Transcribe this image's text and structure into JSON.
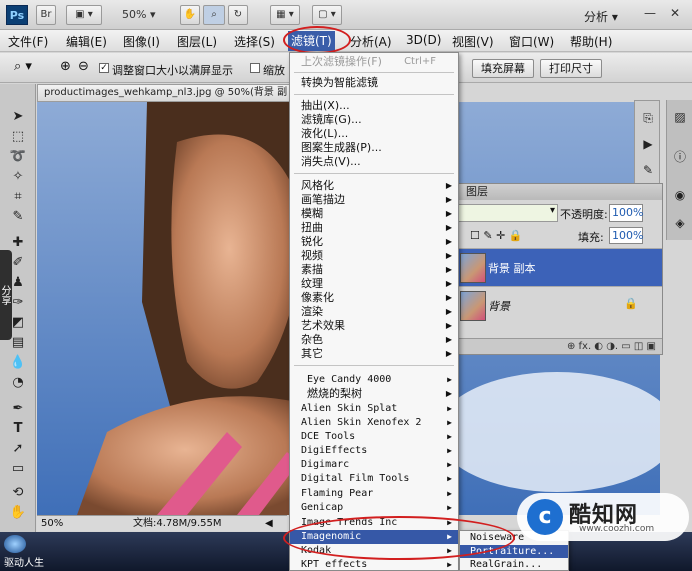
{
  "appbar": {
    "logo": "Ps",
    "br": "Br",
    "zoom": "50%",
    "analysis": "分析",
    "minimize": "—",
    "close": "✕"
  },
  "menubar": {
    "items": [
      "文件(F)",
      "编辑(E)",
      "图像(I)",
      "图层(L)",
      "选择(S)",
      "滤镜(T)",
      "分析(A)",
      "3D(D)",
      "视图(V)",
      "窗口(W)",
      "帮助(H)"
    ]
  },
  "options": {
    "resize_windows": "调整窗口大小以满屏显示",
    "zoom_all": "缩放",
    "fill_screen": "填充屏幕",
    "print_size": "打印尺寸"
  },
  "document": {
    "tab": "productimages_wehkamp_nl3.jpg @ 50%(背景 副",
    "status_zoom": "50%",
    "status_doc": "文档:4.78M/9.55M"
  },
  "side_tab": "分享",
  "taskbar": {
    "label": "驱动人生"
  },
  "filter_menu": {
    "last_filter": "上次滤镜操作(F)",
    "last_filter_shortcut": "Ctrl+F",
    "smart_filter": "转换为智能滤镜",
    "group2": [
      "抽出(X)...",
      "滤镜库(G)...",
      "液化(L)...",
      "图案生成器(P)...",
      "消失点(V)..."
    ],
    "group3": [
      "风格化",
      "画笔描边",
      "模糊",
      "扭曲",
      "锐化",
      "视频",
      "素描",
      "纹理",
      "像素化",
      "渲染",
      "艺术效果",
      "杂色",
      "其它"
    ],
    "group4": [
      "Eye Candy 4000",
      "燃烧的梨树",
      "Alien Skin Splat",
      "Alien Skin Xenofex 2",
      "DCE Tools",
      "DigiEffects",
      "Digimarc",
      "Digital Film Tools",
      "Flaming Pear",
      "Genicap",
      "Image Trends Inc",
      "Imagenomic",
      "Kodak",
      "KPT effects"
    ]
  },
  "submenu": {
    "items": [
      "Noiseware",
      "Portraiture...",
      "RealGrain..."
    ]
  },
  "layers_panel": {
    "title": "图层",
    "opacity_label": "不透明度:",
    "opacity_value": "100%",
    "fill_label": "填充:",
    "fill_value": "100%",
    "layers": [
      "背景 副本",
      "背景"
    ],
    "footer": "⊕ fx. ◐ ◑. ▭ ◫ ▣"
  },
  "watermark": {
    "title": "酷知网",
    "url": "www.coozhi.com"
  }
}
